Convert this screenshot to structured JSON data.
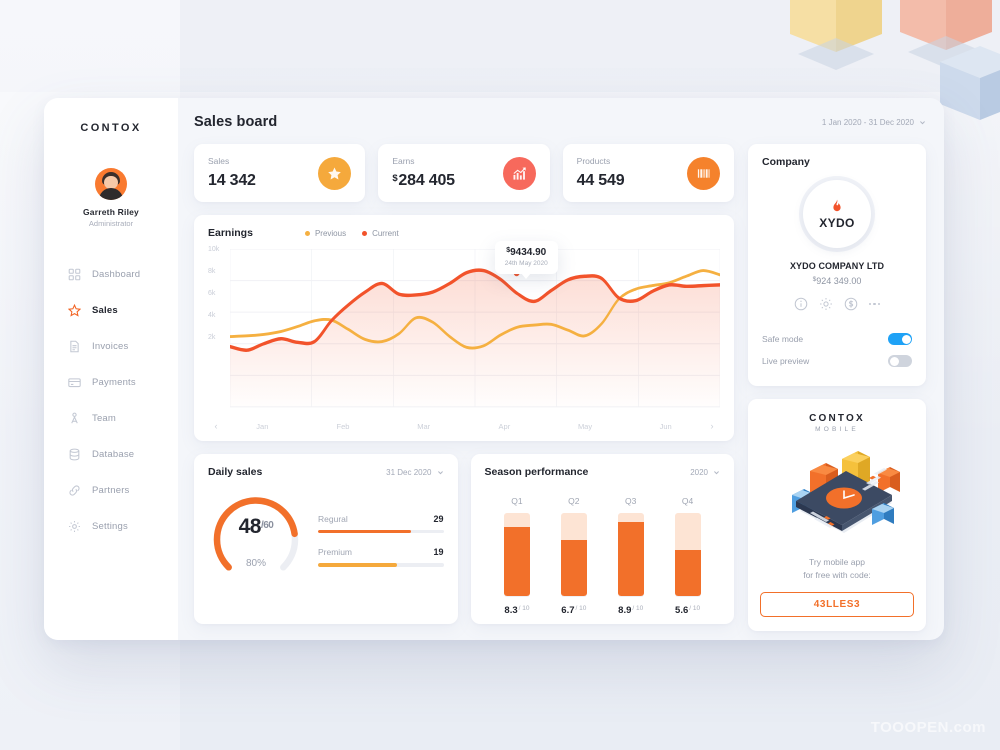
{
  "sidebar": {
    "logo": "CONTOX",
    "user": {
      "name": "Garreth Riley",
      "role": "Administrator",
      "avatar_icon": "user-avatar"
    },
    "items": [
      {
        "label": "Dashboard",
        "icon": "grid-icon",
        "active": false
      },
      {
        "label": "Sales",
        "icon": "star-icon",
        "active": true
      },
      {
        "label": "Invoices",
        "icon": "document-icon",
        "active": false
      },
      {
        "label": "Payments",
        "icon": "card-icon",
        "active": false
      },
      {
        "label": "Team",
        "icon": "people-icon",
        "active": false
      },
      {
        "label": "Database",
        "icon": "database-icon",
        "active": false
      },
      {
        "label": "Partners",
        "icon": "link-icon",
        "active": false
      },
      {
        "label": "Settings",
        "icon": "gear-icon",
        "active": false
      }
    ]
  },
  "header": {
    "title": "Sales board",
    "date_range": "1 Jan 2020 - 31 Dec 2020",
    "caret_icon": "chevron-down-icon"
  },
  "stats": [
    {
      "label": "Sales",
      "value": "14 342",
      "currency": "",
      "icon": "star-icon",
      "color": "#f5a93c"
    },
    {
      "label": "Earns",
      "value": "284 405",
      "currency": "$",
      "icon": "chart-up-icon",
      "color": "#f7695c"
    },
    {
      "label": "Products",
      "value": "44 549",
      "currency": "",
      "icon": "barcode-icon",
      "color": "#f5822c"
    }
  ],
  "earnings": {
    "title": "Earnings",
    "legend": [
      {
        "label": "Previous",
        "color": "#f5b041"
      },
      {
        "label": "Current",
        "color": "#f2532b"
      }
    ],
    "tooltip": {
      "currency": "$",
      "value": "9434.90",
      "date": "24th May 2020"
    },
    "prev_arrow": "chevron-left-icon",
    "next_arrow": "chevron-right-icon"
  },
  "daily_sales": {
    "title": "Daily sales",
    "date": "31 Dec 2020",
    "caret_icon": "chevron-down-icon",
    "gauge": {
      "value": "48",
      "denominator": "/60",
      "percent": "80%",
      "fraction": 0.8
    },
    "rows": [
      {
        "label": "Regural",
        "value": "29",
        "fill": 0.74,
        "color": "#f2702a"
      },
      {
        "label": "Premium",
        "value": "19",
        "fill": 0.63,
        "color": "#f5a93c"
      }
    ]
  },
  "season": {
    "title": "Season performance",
    "year": "2020",
    "caret_icon": "chevron-down-icon"
  },
  "company": {
    "title": "Company",
    "logo_text": "XYDO",
    "logo_icon": "flame-icon",
    "name": "XYDO COMPANY LTD",
    "currency": "$",
    "amount": "924 349.00",
    "actions": [
      {
        "icon": "info-icon"
      },
      {
        "icon": "gear-icon"
      },
      {
        "icon": "dollar-circle-icon"
      },
      {
        "icon": "more-dots-icon"
      }
    ],
    "toggles": [
      {
        "label": "Safe mode",
        "on": true
      },
      {
        "label": "Live preview",
        "on": false
      }
    ]
  },
  "promo": {
    "logo": "CONTOX",
    "logo_sub": "MOBILE",
    "art_icon": "isometric-phone-icon",
    "line1": "Try mobile app",
    "line2": "for free with code:",
    "code": "43LLES3"
  },
  "watermark": "TOOOPEN.com",
  "chart_data": [
    {
      "type": "line",
      "title": "Earnings",
      "xlabel": "",
      "ylabel": "",
      "ylim": [
        0,
        11000
      ],
      "yticks": [
        "2k",
        "4k",
        "6k",
        "8k",
        "10k"
      ],
      "grid": true,
      "legend_position": "top-center",
      "categories": [
        "Jan",
        "Feb",
        "Mar",
        "Apr",
        "May",
        "Jun"
      ],
      "series": [
        {
          "name": "Current",
          "color": "#f2532b",
          "values": [
            4200,
            3950,
            4400,
            4750,
            4500,
            4550,
            6000,
            7100,
            8000,
            8600,
            7850,
            7800,
            8000,
            8600,
            9350,
            9500,
            8900,
            7900,
            7350,
            8100,
            8850,
            9100,
            8950,
            7600,
            7400,
            8050,
            8500,
            8400,
            8450,
            8500
          ]
        },
        {
          "name": "Previous",
          "color": "#f5b041",
          "values": [
            4900,
            4950,
            5050,
            5250,
            5600,
            6000,
            6050,
            5400,
            4700,
            4550,
            5100,
            6200,
            5900,
            4900,
            4150,
            4250,
            5000,
            5550,
            5700,
            5750,
            5350,
            4950,
            5800,
            7500,
            8200,
            8450,
            8650,
            9100,
            9500,
            9200
          ]
        }
      ],
      "annotations": [
        {
          "text": "$9434.90 — 24th May 2020",
          "x": "May",
          "y": 9434.9,
          "marker": true
        }
      ]
    },
    {
      "type": "bar",
      "title": "Season performance",
      "subtitle": "2020",
      "categories": [
        "Q1",
        "Q2",
        "Q3",
        "Q4"
      ],
      "values": [
        8.3,
        6.7,
        8.9,
        5.6
      ],
      "value_labels": [
        "8.3",
        "6.7",
        "8.9",
        "5.6"
      ],
      "denominator": "/ 10",
      "ylim": [
        0,
        10
      ],
      "xlabel": "",
      "ylabel": "",
      "grid": false
    },
    {
      "type": "bar",
      "title": "Daily sales",
      "subtitle": "31 Dec 2020",
      "categories": [
        "Regural",
        "Premium"
      ],
      "values": [
        29,
        19
      ],
      "xlabel": "",
      "ylabel": "",
      "grid": false
    }
  ]
}
